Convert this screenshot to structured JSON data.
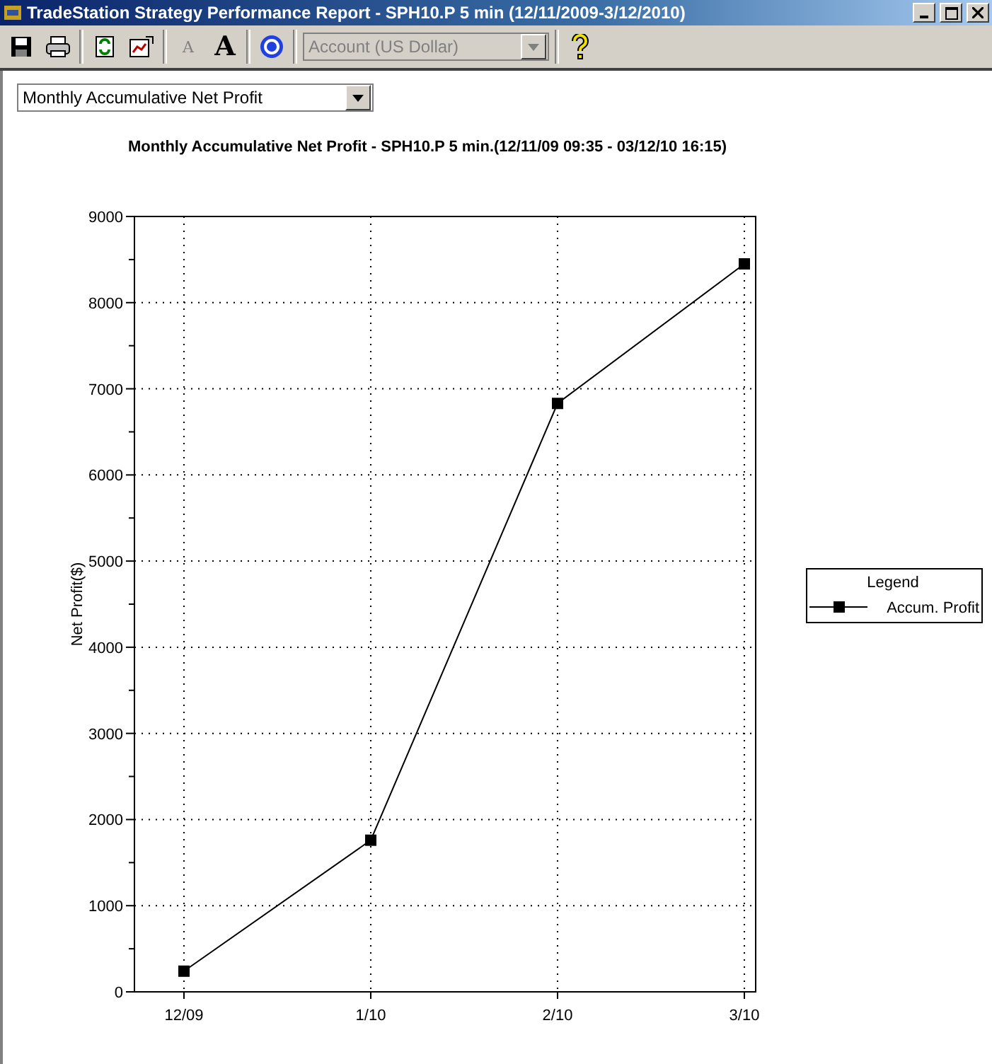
{
  "window": {
    "title": "TradeStation Strategy Performance Report - SPH10.P 5 min (12/11/2009-3/12/2010)"
  },
  "toolbar": {
    "font_smaller": "A",
    "font_larger": "A",
    "account": {
      "value": "Account (US Dollar)",
      "disabled": true
    }
  },
  "report_select": {
    "value": "Monthly Accumulative Net Profit"
  },
  "chart": {
    "chart_data": {
      "type": "line",
      "title": "Monthly Accumulative Net Profit - SPH10.P 5 min.(12/11/09 09:35 - 03/12/10 16:15)",
      "ylabel": "Net Profit($)",
      "categories": [
        "12/09",
        "1/10",
        "2/10",
        "3/10"
      ],
      "series": [
        {
          "name": "Accum. Profit",
          "color": "#000000",
          "marker": "square",
          "values": [
            240,
            1760,
            6830,
            8450
          ]
        }
      ],
      "ylim": [
        0,
        9000
      ],
      "grid": true,
      "yticks": [
        0,
        1000,
        2000,
        3000,
        4000,
        5000,
        6000,
        7000,
        8000,
        9000
      ]
    },
    "legend_title": "Legend"
  }
}
